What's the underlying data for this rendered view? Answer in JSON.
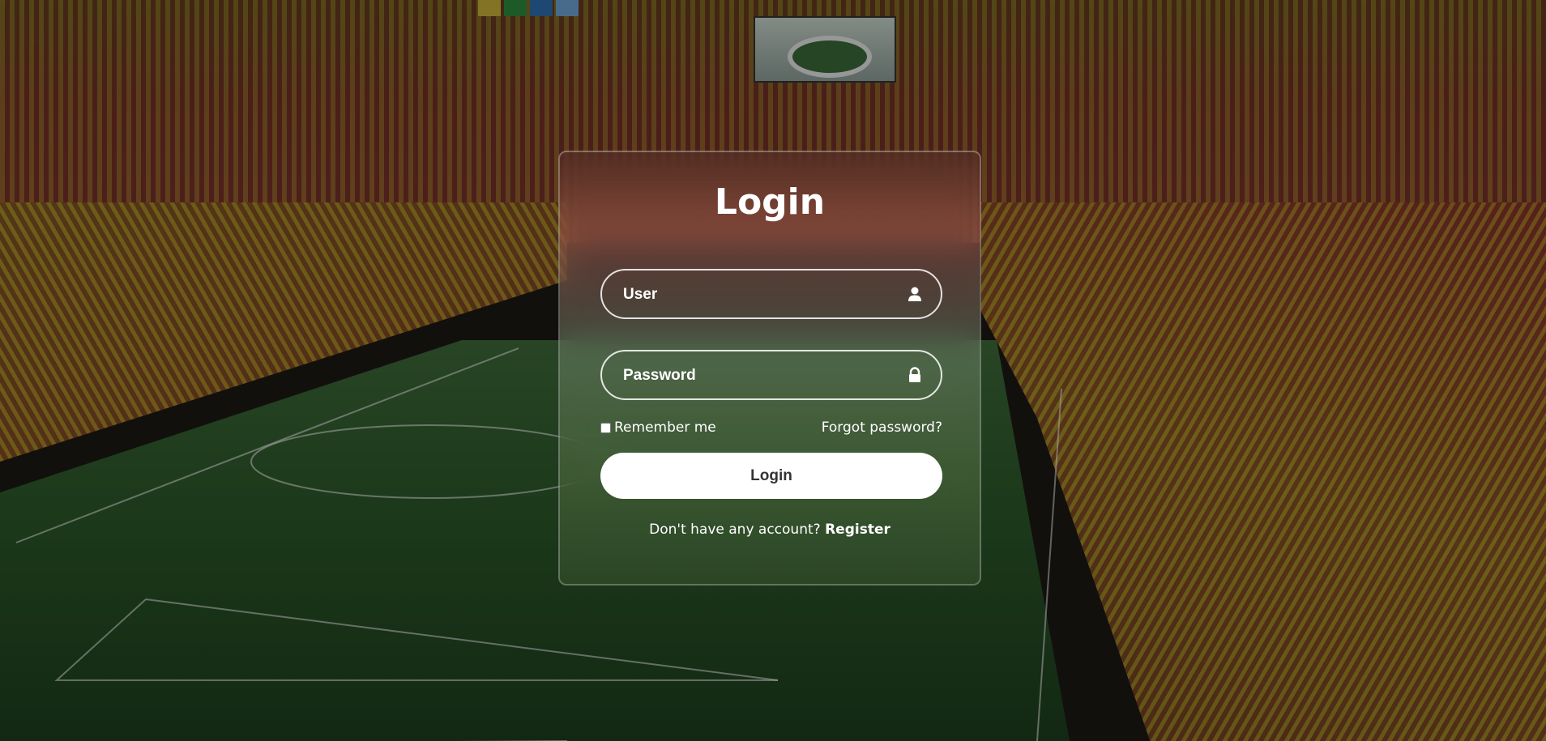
{
  "login": {
    "title": "Login",
    "user_placeholder": "User",
    "password_placeholder": "Password",
    "remember_label": "Remember me",
    "forgot_label": "Forgot password?",
    "submit_label": "Login",
    "no_account_text": "Don't have any account?",
    "register_label": "Register",
    "user_icon": "user-icon",
    "password_icon": "lock-icon"
  },
  "colors": {
    "text": "#ffffff",
    "button_bg": "#ffffff",
    "button_text": "#333333"
  }
}
